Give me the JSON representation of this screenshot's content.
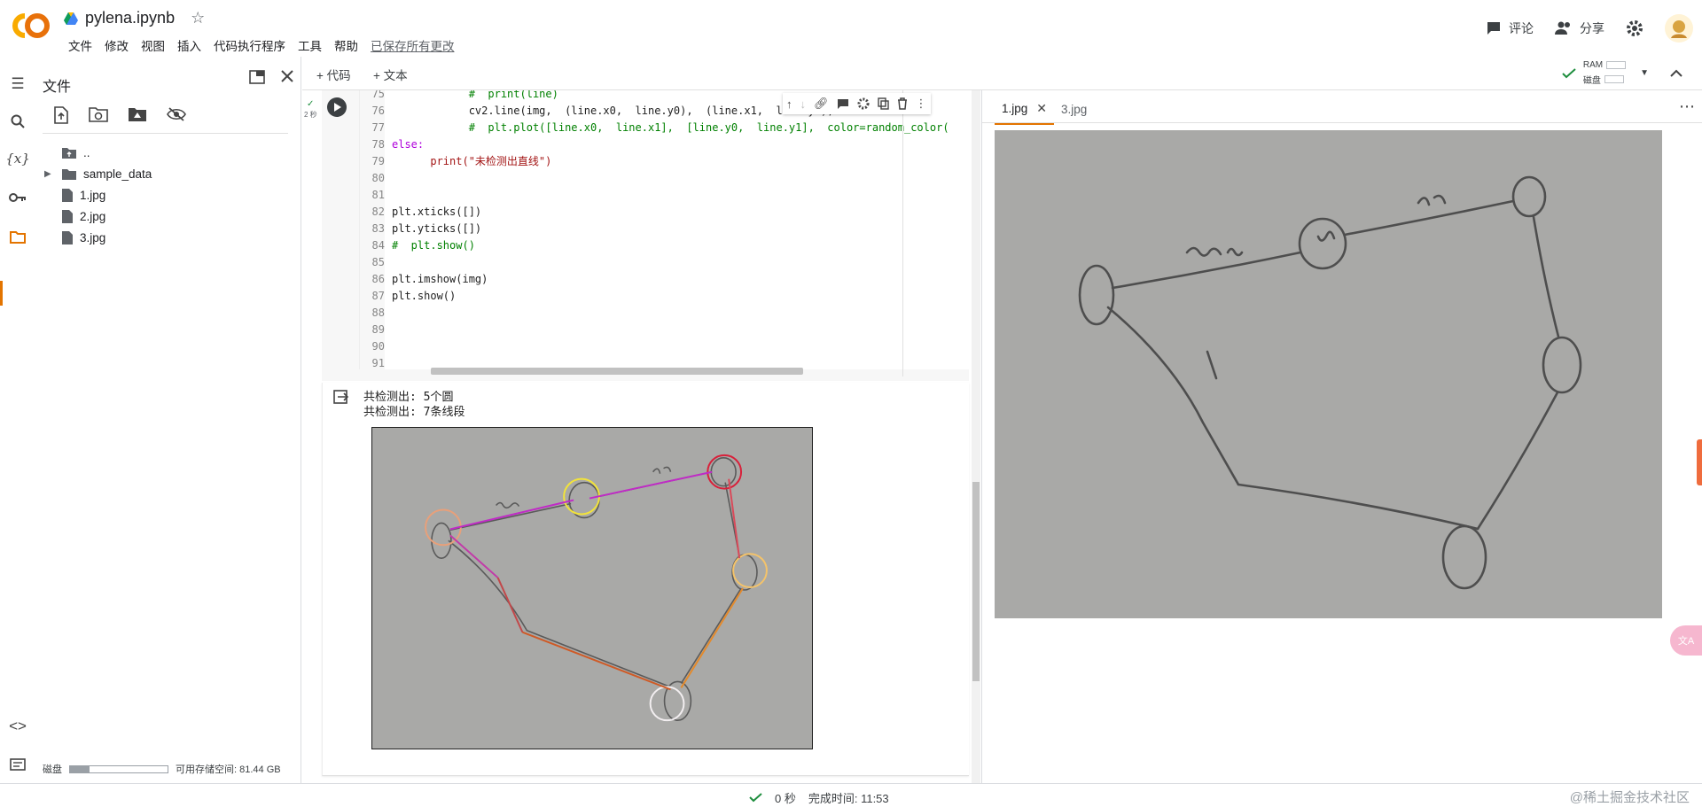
{
  "header": {
    "title": "pylena.ipynb",
    "menus": [
      "文件",
      "修改",
      "视图",
      "插入",
      "代码执行程序",
      "工具",
      "帮助"
    ],
    "saved_status": "已保存所有更改",
    "comment_label": "评论",
    "share_label": "分享"
  },
  "files": {
    "title": "文件",
    "items": [
      {
        "name": "..",
        "type": "folder-up"
      },
      {
        "name": "sample_data",
        "type": "folder"
      },
      {
        "name": "1.jpg",
        "type": "file"
      },
      {
        "name": "2.jpg",
        "type": "file"
      },
      {
        "name": "3.jpg",
        "type": "file"
      }
    ],
    "disk_label": "磁盘",
    "disk_used_fraction": 0.2,
    "available_label": "可用存储空间: 81.44 GB"
  },
  "toolbar": {
    "add_code": "+ 代码",
    "add_text": "+ 文本",
    "ram_label": "RAM",
    "disk_label": "磁盘"
  },
  "cell": {
    "exec_time": "2 秒",
    "line_numbers": [
      "75",
      "76",
      "77",
      "78",
      "79",
      "80",
      "81",
      "82",
      "83",
      "84",
      "85",
      "86",
      "87",
      "88",
      "89",
      "90",
      "91"
    ],
    "code_lines": [
      "            #  print(line)",
      "            cv2.line(img,  (line.x0,  line.y0),  (line.x1,  line.y1),  ...",
      "            #  plt.plot([line.x0,  line.x1],  [line.y0,  line.y1],  color=random_color(",
      "else:",
      "      print(\"未检测出直线\")",
      "",
      "",
      "plt.xticks([])",
      "plt.yticks([])",
      "#  plt.show()",
      "",
      "plt.imshow(img)",
      "plt.show()",
      "",
      "",
      "",
      ""
    ],
    "output_lines": [
      "共检测出: 5个圆",
      "共检测出: 7条线段"
    ]
  },
  "viewer": {
    "tabs": [
      {
        "label": "1.jpg",
        "active": true
      },
      {
        "label": "3.jpg",
        "active": false
      }
    ]
  },
  "status": {
    "elapsed": "0 秒",
    "completed": "完成时间: 11:53",
    "watermark": "@稀土掘金技术社区"
  },
  "colors": {
    "accent": "#e37400",
    "logo_orange": "#f9ab00",
    "logo_dark": "#e8710a"
  }
}
